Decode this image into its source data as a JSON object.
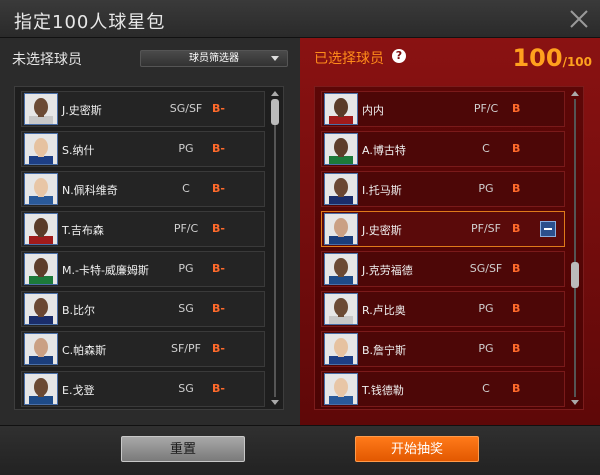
{
  "window": {
    "title": "指定100人球星包"
  },
  "left_panel": {
    "header": "未选择球员",
    "filter_label": "球员筛选器",
    "players": [
      {
        "name": "J.史密斯",
        "position": "SG/SF",
        "rating": "B-"
      },
      {
        "name": "S.纳什",
        "position": "PG",
        "rating": "B-"
      },
      {
        "name": "N.佩科维奇",
        "position": "C",
        "rating": "B-"
      },
      {
        "name": "T.吉布森",
        "position": "PF/C",
        "rating": "B-"
      },
      {
        "name": "M.-卡特-威廉姆斯",
        "position": "PG",
        "rating": "B-"
      },
      {
        "name": "B.比尔",
        "position": "SG",
        "rating": "B-"
      },
      {
        "name": "C.帕森斯",
        "position": "SF/PF",
        "rating": "B-"
      },
      {
        "name": "E.戈登",
        "position": "SG",
        "rating": "B-"
      }
    ],
    "scroll_position": 0.0
  },
  "right_panel": {
    "header": "已选择球员",
    "help_icon": "question-icon",
    "count": "100",
    "count_total": "/100",
    "players": [
      {
        "name": "内内",
        "position": "PF/C",
        "rating": "B"
      },
      {
        "name": "A.博古特",
        "position": "C",
        "rating": "B"
      },
      {
        "name": "I.托马斯",
        "position": "PG",
        "rating": "B"
      },
      {
        "name": "J.史密斯",
        "position": "PF/SF",
        "rating": "B",
        "selected": true
      },
      {
        "name": "J.克劳福德",
        "position": "SG/SF",
        "rating": "B"
      },
      {
        "name": "R.卢比奥",
        "position": "PG",
        "rating": "B"
      },
      {
        "name": "B.詹宁斯",
        "position": "PG",
        "rating": "B"
      },
      {
        "name": "T.钱德勒",
        "position": "C",
        "rating": "B"
      }
    ],
    "scroll_position": 0.6
  },
  "buttons": {
    "reset": "重置",
    "draw": "开始抽奖"
  },
  "colors": {
    "accent_orange": "#ff8c1a",
    "rating_red": "#ff6a2b",
    "selected_panel": "#8a1212"
  }
}
